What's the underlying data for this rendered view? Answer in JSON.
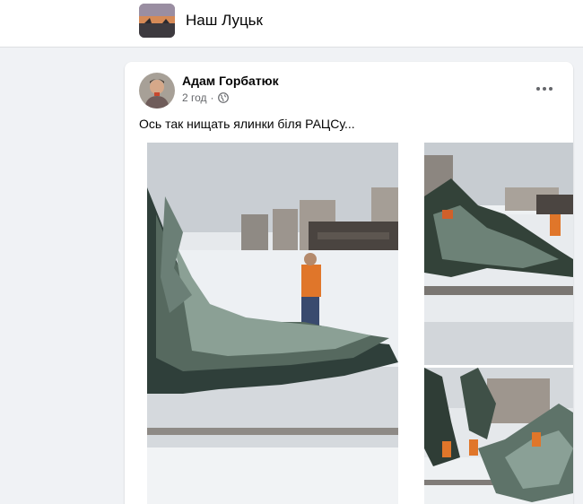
{
  "group": {
    "name": "Наш Луцьк"
  },
  "post": {
    "author": "Адам Горбатюк",
    "time": "2 год",
    "text": "Ось так нищать ялинки біля РАЦСу..."
  },
  "photos": [
    {
      "label": "photo-trees-worker"
    },
    {
      "label": "photo-trees-street"
    },
    {
      "label": "photo-workers-trees"
    }
  ],
  "icons": [
    "globe-icon",
    "more-icon"
  ]
}
